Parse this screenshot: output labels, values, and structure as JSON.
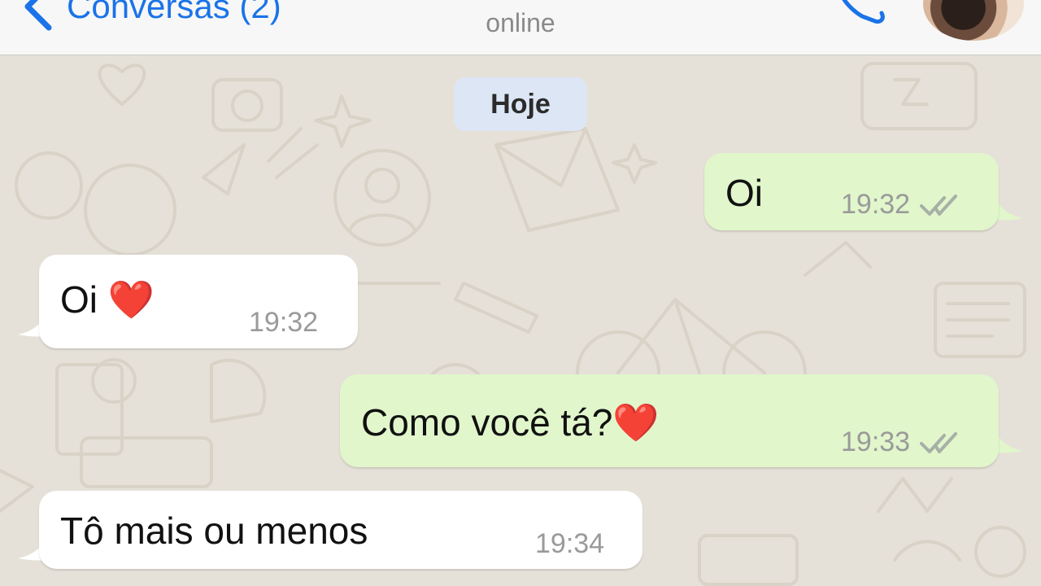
{
  "header": {
    "back_label": "Conversas (2)",
    "status": "online"
  },
  "chat": {
    "day_label": "Hoje",
    "messages": [
      {
        "direction": "outgoing",
        "text": "Oi",
        "time": "19:32",
        "read": true
      },
      {
        "direction": "incoming",
        "text": "Oi ❤️",
        "time": "19:32"
      },
      {
        "direction": "outgoing",
        "text": "Como você tá?❤️",
        "time": "19:33",
        "read": true
      },
      {
        "direction": "incoming",
        "text": "Tô mais ou menos",
        "time": "19:34"
      }
    ]
  },
  "icons": {
    "back": "chevron-left-icon",
    "call": "phone-icon",
    "read_receipt": "double-check-icon"
  },
  "colors": {
    "accent": "#1a73e8",
    "outgoing_bubble": "#e1f6cb",
    "incoming_bubble": "#ffffff",
    "wallpaper": "#e6e1d8",
    "day_pill": "#dce6f5"
  }
}
